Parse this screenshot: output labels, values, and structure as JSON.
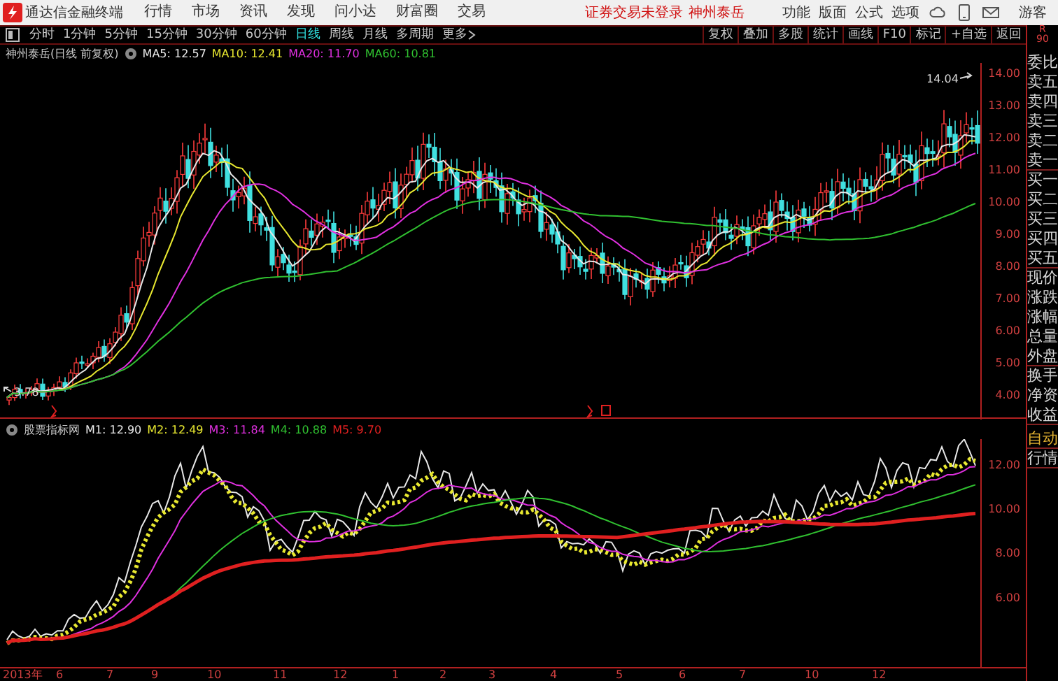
{
  "app": {
    "title": "通达信金融终端",
    "menu": [
      "行情",
      "市场",
      "资讯",
      "发现",
      "问小达",
      "财富圈",
      "交易"
    ],
    "login_status": "证券交易未登录",
    "stock_link": "神州泰岳",
    "tools": [
      "功能",
      "版面",
      "公式",
      "选项"
    ],
    "user": "游客"
  },
  "periods": [
    {
      "label": "分时",
      "selected": false
    },
    {
      "label": "1分钟",
      "selected": false
    },
    {
      "label": "5分钟",
      "selected": false
    },
    {
      "label": "15分钟",
      "selected": false
    },
    {
      "label": "30分钟",
      "selected": false
    },
    {
      "label": "60分钟",
      "selected": false
    },
    {
      "label": "日线",
      "selected": true
    },
    {
      "label": "周线",
      "selected": false
    },
    {
      "label": "月线",
      "selected": false
    },
    {
      "label": "多周期",
      "selected": false
    }
  ],
  "more": "更多",
  "chart_tools": [
    "复权",
    "叠加",
    "多股",
    "统计",
    "画线",
    "F10",
    "标记",
    "+自选",
    "返回"
  ],
  "corner": [
    "R",
    "90"
  ],
  "main_chart": {
    "title": "神州泰岳(日线 前复权)",
    "ma": [
      {
        "label": "MA5: 12.57",
        "color": "#e8e8e8"
      },
      {
        "label": "MA10: 12.41",
        "color": "#e8e830"
      },
      {
        "label": "MA20: 11.70",
        "color": "#e030e0"
      },
      {
        "label": "MA60: 10.81",
        "color": "#30c030"
      }
    ],
    "high_label": "14.04",
    "low_label": "3.78",
    "price_axis": [
      "14.00",
      "13.00",
      "12.00",
      "11.00",
      "10.00",
      "9.00",
      "8.00",
      "7.00",
      "6.00",
      "5.00",
      "4.00"
    ]
  },
  "indicator": {
    "title": "股票指标网",
    "lines": [
      {
        "label": "M1: 12.90",
        "color": "#e8e8e8"
      },
      {
        "label": "M2: 12.49",
        "color": "#e8e830"
      },
      {
        "label": "M3: 11.84",
        "color": "#e030e0"
      },
      {
        "label": "M4: 10.88",
        "color": "#30c030"
      },
      {
        "label": "M5: 9.70",
        "color": "#e02020"
      }
    ],
    "axis": [
      "12.00",
      "10.00",
      "8.00",
      "6.00"
    ]
  },
  "date_axis": [
    "2013年",
    "6",
    "7",
    "9",
    "10",
    "11",
    "12",
    "1",
    "2",
    "3",
    "4",
    "5",
    "6",
    "7",
    "10",
    "12"
  ],
  "side_panel": [
    "委比",
    "卖五",
    "卖四",
    "卖三",
    "卖二",
    "卖一",
    "买一",
    "买二",
    "买三",
    "买四",
    "买五",
    "现价",
    "涨跌",
    "涨幅",
    "总量",
    "外盘",
    "换手",
    "净资",
    "收益"
  ],
  "side_buttons": [
    "自动",
    "行情"
  ]
}
